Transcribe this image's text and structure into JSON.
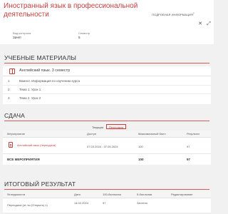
{
  "header": {
    "title": "Иностранный язык в профессиональной деятельности",
    "details_link": "ПОДРОБНАЯ ИНФОРМАЦИЯ",
    "control_label": "Вид контроля",
    "control_value": "Зачёт",
    "semester_label": "Семестр",
    "semester_value": "5",
    "icons": {
      "close": "close-icon",
      "expand": "expand-icon",
      "details": "chevron-icon"
    }
  },
  "materials": {
    "title": "УЧЕБНЫЕ МАТЕРИАЛЫ",
    "card_title": "Английский язык. 3 семестр",
    "items": [
      {
        "num": "1",
        "label": "Важно!. Информация по изучению курса"
      },
      {
        "num": "2",
        "label": "Тема 1. Урок 1"
      },
      {
        "num": "3",
        "label": "Тема 2. Урок 2"
      }
    ]
  },
  "submission": {
    "title": "СДАЧА",
    "tabs": [
      "Текущая",
      "Пересдача"
    ],
    "active_tab": "Пересдача",
    "columns": [
      "Мероприятие",
      "Доступ",
      "Максимальный балл",
      "Результат"
    ],
    "rows": [
      {
        "event": "Английский язык (пересдача)",
        "access": "07.03.2024 - 07.05.2024",
        "max": "100",
        "result": "97"
      }
    ],
    "total": {
      "label": "ВСЕ МЕРОПРИЯТИЯ",
      "max": "100",
      "result": "97"
    }
  },
  "final": {
    "title": "ИТОГОВЫЙ РЕЗУЛЬТАТ",
    "columns": [
      "№ ведомости",
      "Дата",
      "100-балльная",
      "5-балльная",
      "Редактирование"
    ],
    "rows": [
      {
        "sheet": "Пересдача (от-ты (Открыть) x)",
        "date": "14.02.2024",
        "score100": "97",
        "score5": "Зачтено",
        "edit": ""
      }
    ]
  },
  "colors": {
    "accent": "#c8403e",
    "background": "#f1f1f1",
    "card": "#ffffff"
  }
}
